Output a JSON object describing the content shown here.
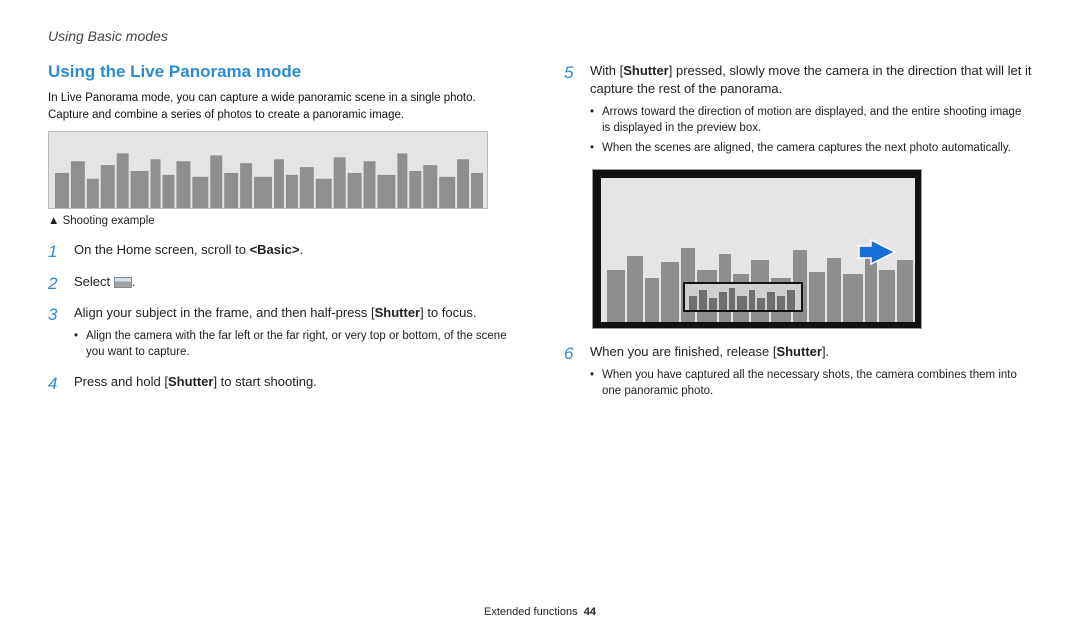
{
  "header": "Using Basic modes",
  "section_title": "Using the Live Panorama mode",
  "intro": "In Live Panorama mode, you can capture a wide panoramic scene in a single photo. Capture and combine a series of photos to create a panoramic image.",
  "caption": "Shooting example",
  "steps": {
    "s1": {
      "num": "1",
      "pre": "On the Home screen, scroll to ",
      "bold": "<Basic>",
      "post": "."
    },
    "s2": {
      "num": "2",
      "pre": "Select ",
      "post": "."
    },
    "s3": {
      "num": "3",
      "pre": "Align your subject in the frame, and then half-press [",
      "bold": "Shutter",
      "post": "] to focus.",
      "sub1": "Align the camera with the far left or the far right, or very top or bottom, of the scene you want to capture."
    },
    "s4": {
      "num": "4",
      "pre": "Press and hold [",
      "bold": "Shutter",
      "post": "] to start shooting."
    },
    "s5": {
      "num": "5",
      "pre": "With [",
      "bold": "Shutter",
      "post": "] pressed, slowly move the camera in the direction that will let it capture the rest of the panorama.",
      "sub1": "Arrows toward the direction of motion are displayed, and the entire shooting image is displayed in the preview box.",
      "sub2": "When the scenes are aligned, the camera captures the next photo automatically."
    },
    "s6": {
      "num": "6",
      "pre": "When you are finished, release [",
      "bold": "Shutter",
      "post": "].",
      "sub1": "When you have captured all the necessary shots, the camera combines them into one panoramic photo."
    }
  },
  "footer": {
    "section": "Extended functions",
    "page": "44"
  }
}
